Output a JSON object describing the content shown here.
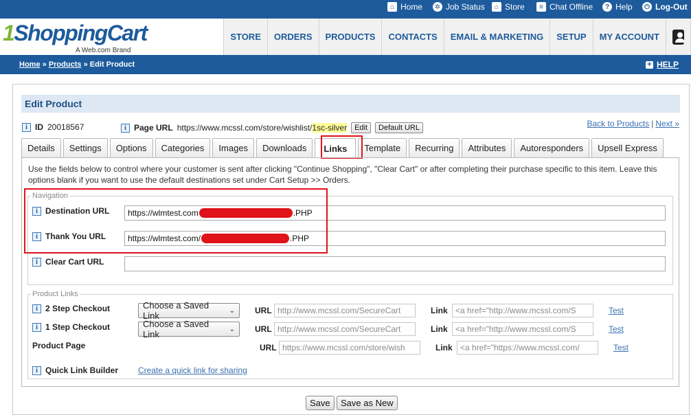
{
  "topbar": {
    "home": "Home",
    "job_status": "Job Status",
    "store": "Store",
    "chat": "Chat Offline",
    "help": "Help",
    "logout": "Log-Out"
  },
  "logo": {
    "one": "1",
    "rest": "ShoppingCart",
    "sub": "A Web.com Brand"
  },
  "nav": [
    "STORE",
    "ORDERS",
    "PRODUCTS",
    "CONTACTS",
    "EMAIL & MARKETING",
    "SETUP",
    "MY ACCOUNT"
  ],
  "breadcrumb": {
    "home": "Home",
    "sep1": "»",
    "products": "Products",
    "sep2": "»",
    "current": "Edit Product"
  },
  "help_label": "HELP",
  "page_title": "Edit Product",
  "product": {
    "id_label": "ID",
    "id": "20018567",
    "page_url_label": "Page URL",
    "page_url_prefix": "https://www.mcssl.com/store/wishlist/",
    "page_url_slug": "1sc-silver",
    "edit_btn": "Edit",
    "default_url_btn": "Default URL",
    "back_link": "Back to Products",
    "separator": "|",
    "next_link": "Next »"
  },
  "tabs": [
    "Details",
    "Settings",
    "Options",
    "Categories",
    "Images",
    "Downloads",
    "Links",
    "Template",
    "Recurring",
    "Attributes",
    "Autoresponders",
    "Upsell Express"
  ],
  "active_tab": "Links",
  "description": "Use the fields below to control where your customer is sent after clicking \"Continue Shopping\", \"Clear Cart\" or after completing their purchase specific to this item. Leave this options blank if you want to use the default destinations set under Cart Setup >> Orders.",
  "navigation": {
    "legend": "Navigation",
    "destination_label": "Destination URL",
    "destination_prefix": "https://wlmtest.com",
    "destination_suffix": ".PHP",
    "thankyou_label": "Thank You URL",
    "thankyou_prefix": "https://wlmtest.com/",
    "thankyou_suffix": ".PHP",
    "clearcart_label": "Clear Cart URL",
    "clearcart_value": ""
  },
  "product_links": {
    "legend": "Product Links",
    "rows": [
      {
        "label": "2 Step Checkout",
        "select": "Choose a Saved Link",
        "url_label": "URL",
        "url": "http://www.mcssl.com/SecureCart",
        "link_label": "Link",
        "link": "<a href=\"http://www.mcssl.com/S",
        "test": "Test"
      },
      {
        "label": "1 Step Checkout",
        "select": "Choose a Saved Link",
        "url_label": "URL",
        "url": "http://www.mcssl.com/SecureCart",
        "link_label": "Link",
        "link": "<a href=\"http://www.mcssl.com/S",
        "test": "Test"
      },
      {
        "label": "Product Page",
        "url_label": "URL",
        "url": "https://www.mcssl.com/store/wish",
        "link_label": "Link",
        "link": "<a href=\"https://www.mcssl.com/",
        "test": "Test"
      }
    ],
    "quick_label": "Quick Link Builder",
    "quick_link": "Create a quick link for sharing"
  },
  "buttons": {
    "save": "Save",
    "save_as_new": "Save as New"
  },
  "colors": {
    "brand_blue": "#1d5b9c",
    "brand_green": "#7fb535",
    "highlight_red": "#e0121a"
  }
}
